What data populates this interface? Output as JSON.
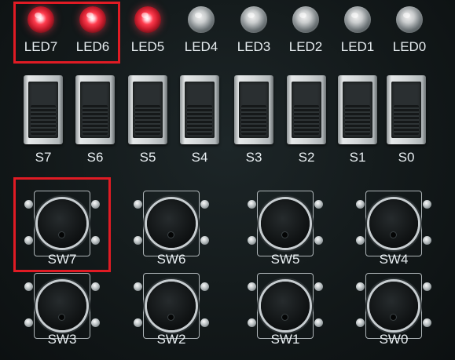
{
  "leds": [
    {
      "label": "LED7",
      "state": "on"
    },
    {
      "label": "LED6",
      "state": "on"
    },
    {
      "label": "LED5",
      "state": "on"
    },
    {
      "label": "LED4",
      "state": "off"
    },
    {
      "label": "LED3",
      "state": "off"
    },
    {
      "label": "LED2",
      "state": "off"
    },
    {
      "label": "LED1",
      "state": "off"
    },
    {
      "label": "LED0",
      "state": "off"
    }
  ],
  "slide_switches": [
    "S7",
    "S6",
    "S5",
    "S4",
    "S3",
    "S2",
    "S1",
    "S0"
  ],
  "push_buttons": [
    "SW7",
    "SW6",
    "SW5",
    "SW4",
    "SW3",
    "SW2",
    "SW1",
    "SW0"
  ],
  "colors": {
    "board": "#121819",
    "highlight": "#e01b24",
    "led_on": "#ff3c4e",
    "text": "#e6ecef"
  }
}
